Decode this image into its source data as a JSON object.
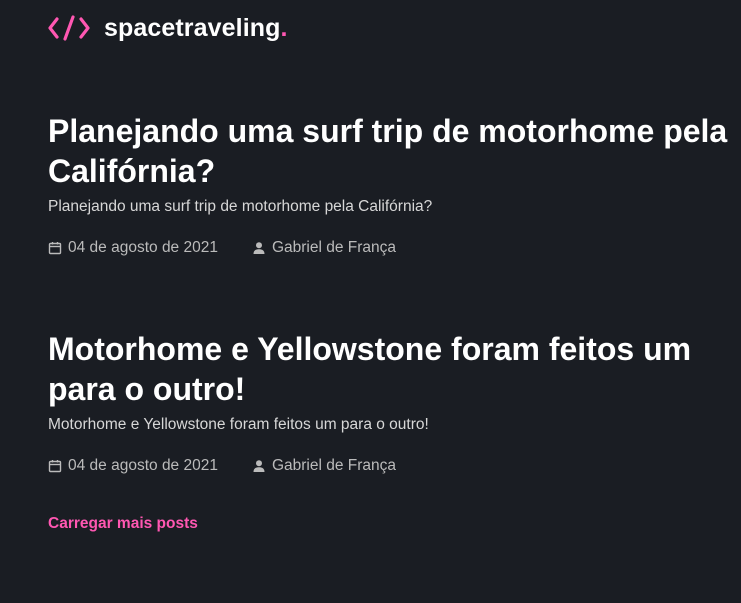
{
  "header": {
    "logo_icon": "code-brackets-icon",
    "logo_text": "spacetraveling",
    "logo_dot": ".",
    "accent_color": "#ff57b2"
  },
  "posts": [
    {
      "title": "Planejando uma surf trip de motorhome pela Califórnia?",
      "subtitle": "Planejando uma surf trip de motorhome pela Califórnia?",
      "date": "04 de agosto de 2021",
      "author": "Gabriel de França",
      "date_icon": "calendar-icon",
      "author_icon": "user-icon"
    },
    {
      "title": "Motorhome e Yellowstone foram feitos um para o outro!",
      "subtitle": "Motorhome e Yellowstone foram feitos um para o outro!",
      "date": "04 de agosto de 2021",
      "author": "Gabriel de França",
      "date_icon": "calendar-icon",
      "author_icon": "user-icon"
    }
  ],
  "load_more_label": "Carregar mais posts",
  "colors": {
    "background": "#1a1d23",
    "title": "#ffffff",
    "body_text": "#d7d7d7",
    "meta_text": "#bbbbbb"
  }
}
